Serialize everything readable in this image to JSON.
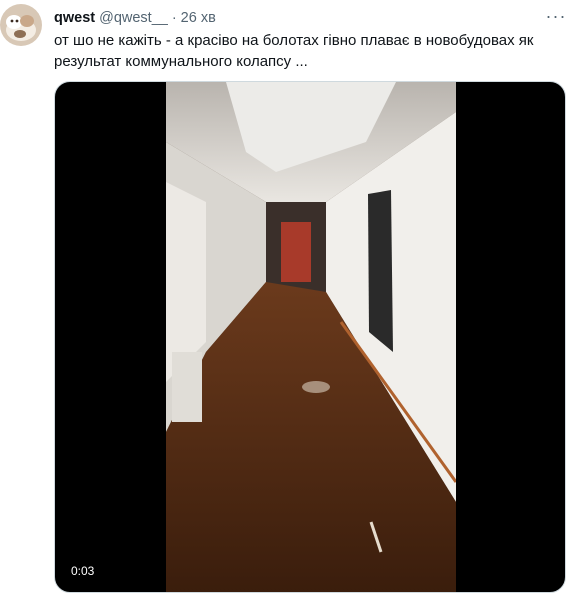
{
  "tweet": {
    "author_name": "qwest",
    "author_handle": "@qwest__",
    "separator": "·",
    "time": "26 хв",
    "text": "от шо не кажіть - а красіво на болотах гівно плаває в новобудовах як результат коммунального колапсу ...",
    "more_label": "···",
    "media": {
      "duration": "0:03",
      "description_icon": "video-thumbnail"
    }
  },
  "colors": {
    "text_primary": "#0f1419",
    "text_secondary": "#536471",
    "media_bg": "#000000",
    "border": "#cfd9de"
  }
}
